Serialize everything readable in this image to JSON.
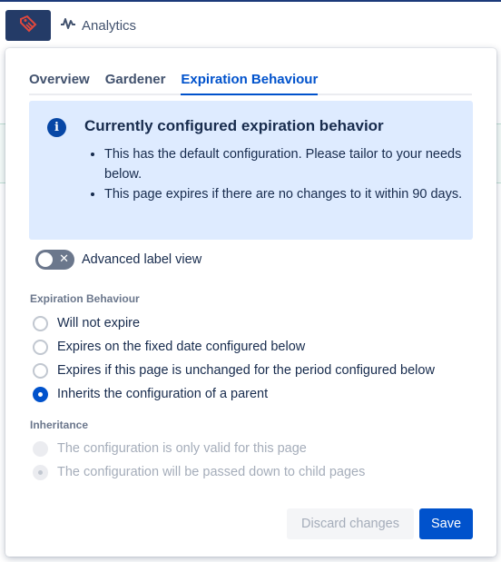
{
  "toolbar": {
    "analytics_label": "Analytics"
  },
  "popup": {
    "tabs": [
      {
        "label": "Overview"
      },
      {
        "label": "Gardener"
      },
      {
        "label": "Expiration Behaviour"
      }
    ],
    "info": {
      "title": "Currently configured expiration behavior",
      "bullets": [
        "This has the default configuration. Please tailor to your needs below.",
        "This page expires if there are no changes to it within 90 days."
      ]
    },
    "toggle": {
      "label": "Advanced label view",
      "on": false
    },
    "expiration": {
      "heading": "Expiration Behaviour",
      "options": [
        {
          "label": "Will not expire",
          "checked": false
        },
        {
          "label": "Expires on the fixed date configured below",
          "checked": false
        },
        {
          "label": "Expires if this page is unchanged for the period configured below",
          "checked": false
        },
        {
          "label": "Inherits the configuration of a parent",
          "checked": true
        }
      ]
    },
    "inheritance": {
      "heading": "Inheritance",
      "options": [
        {
          "label": "The configuration is only valid for this page",
          "checked": false
        },
        {
          "label": "The configuration will be passed down to child pages",
          "checked": true
        }
      ]
    },
    "buttons": {
      "discard": "Discard changes",
      "save": "Save"
    }
  },
  "colors": {
    "primary": "#0052cc",
    "info_bg": "#deebff",
    "toolbar_btn": "#243b67"
  }
}
